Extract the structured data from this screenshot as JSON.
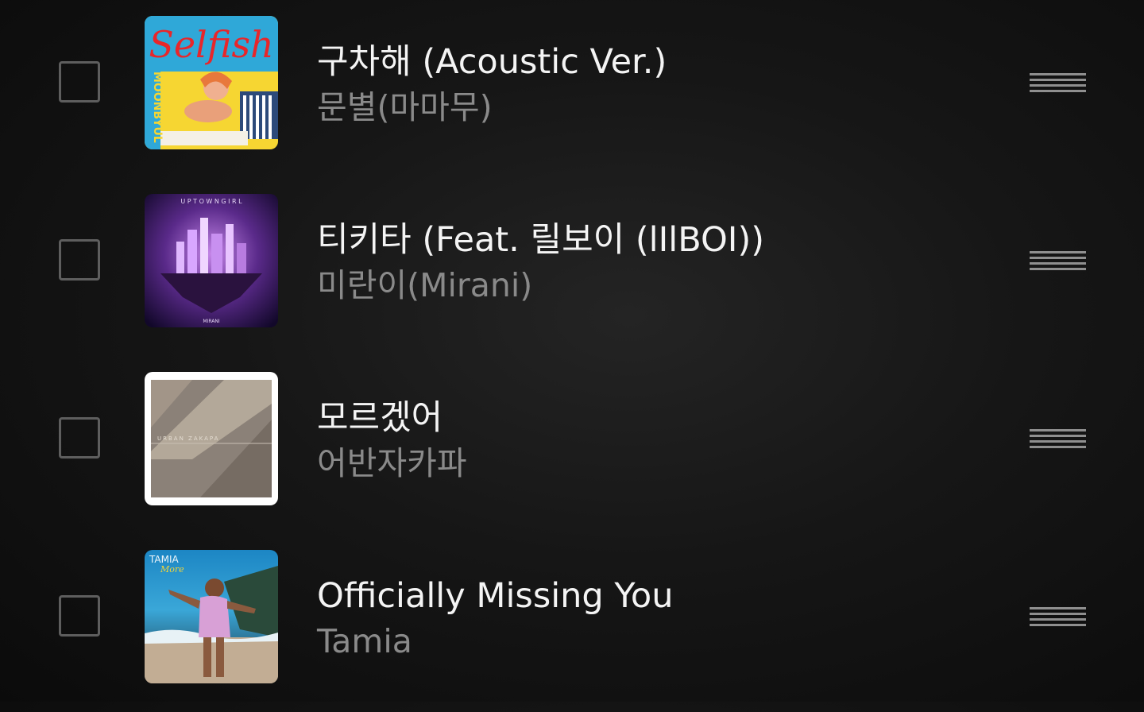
{
  "tracks": [
    {
      "title": "구차해 (Acoustic Ver.)",
      "artist": "문별(마마무)",
      "art_text": "Selfish",
      "art_sub": "MOONBYUL"
    },
    {
      "title": "티키타 (Feat. 릴보이 (lIlBOI))",
      "artist": "미란이(Mirani)",
      "art_text": "U P T O W N    G I R L",
      "art_sub": "MIRANI"
    },
    {
      "title": "모르겠어",
      "artist": "어반자카파",
      "art_text": "URBAN ZAKAPA"
    },
    {
      "title": "Officially Missing You",
      "artist": "Tamia",
      "art_text": "TAMIA",
      "art_sub": "More"
    }
  ],
  "colors": {
    "title": "#f4f4f4",
    "artist": "#8a8a8a",
    "checkbox_border": "#5e5e5e",
    "handle": "#8f8f8f"
  },
  "icons": {
    "checkbox": "checkbox-unchecked-icon",
    "handle": "drag-handle-icon"
  }
}
